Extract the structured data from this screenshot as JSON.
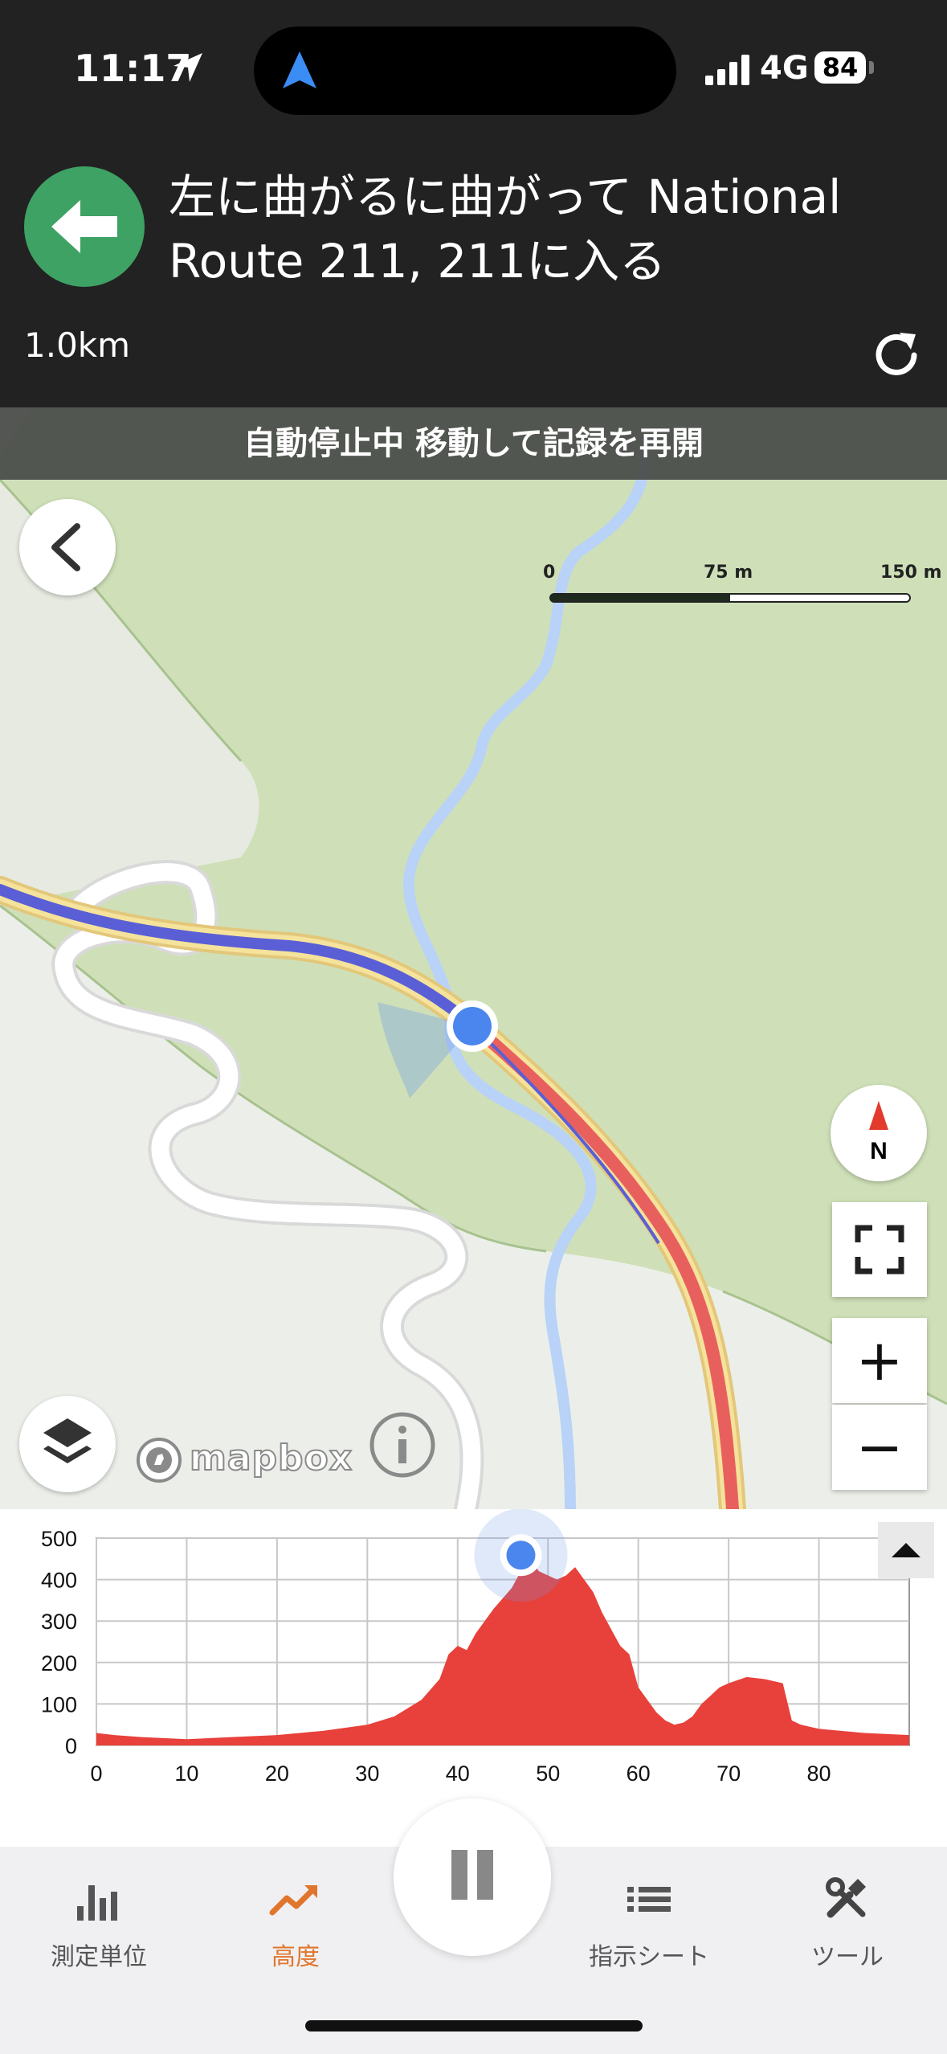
{
  "status_bar": {
    "time": "11:17",
    "network": "4G",
    "battery": "84"
  },
  "navigation": {
    "instruction": "左に曲がるに曲がって National Route 211, 211に入る",
    "distance": "1.0km",
    "turn_icon": "arrow-left-icon",
    "turn_color": "#3fa265"
  },
  "map": {
    "autopause_banner": "自動停止中 移動して記録を再開",
    "scale": {
      "label_0": "0",
      "label_mid": "75 m",
      "label_max": "150 m"
    },
    "compass_label": "N",
    "zoom_in": "+",
    "zoom_out": "−",
    "attribution": "mapbox",
    "route_colors": {
      "traveled": "#5a5fd6",
      "planned": "#e8605d",
      "road": "#f5e39c",
      "water": "#b9d2f7",
      "forest": "#cfe0b8"
    }
  },
  "chart_data": {
    "type": "area",
    "title": "",
    "xlabel": "",
    "ylabel": "",
    "x_ticks": [
      0,
      10,
      20,
      30,
      40,
      50,
      60,
      70,
      80
    ],
    "y_ticks": [
      0,
      100,
      200,
      300,
      400,
      500
    ],
    "xlim": [
      0,
      90
    ],
    "ylim": [
      0,
      500
    ],
    "grid": true,
    "color": "#e8403a",
    "current_position_x": 47,
    "series": [
      {
        "x": [
          0,
          2,
          5,
          10,
          15,
          20,
          25,
          30,
          33,
          36,
          38,
          39,
          40,
          41,
          42,
          44,
          46,
          47,
          48,
          49,
          50,
          51,
          52,
          53,
          54,
          55,
          56,
          57,
          58,
          59,
          60,
          61,
          62,
          63,
          64,
          65,
          66,
          67,
          68,
          69,
          70,
          72,
          74,
          76,
          77,
          78,
          80,
          85,
          90
        ],
        "values": [
          30,
          25,
          20,
          15,
          20,
          25,
          35,
          50,
          70,
          110,
          160,
          220,
          240,
          230,
          270,
          330,
          380,
          420,
          450,
          420,
          410,
          400,
          410,
          430,
          400,
          370,
          320,
          280,
          240,
          220,
          140,
          110,
          80,
          60,
          50,
          55,
          70,
          100,
          120,
          140,
          150,
          165,
          160,
          150,
          60,
          50,
          40,
          30,
          25
        ]
      }
    ]
  },
  "tabs": [
    {
      "label": "測定単位",
      "icon": "bar-chart-icon"
    },
    {
      "label": "高度",
      "icon": "elevation-icon",
      "active": true
    },
    {
      "label": "指示シート",
      "icon": "list-icon"
    },
    {
      "label": "ツール",
      "icon": "tools-icon"
    }
  ],
  "pause_icon": "pause-icon"
}
